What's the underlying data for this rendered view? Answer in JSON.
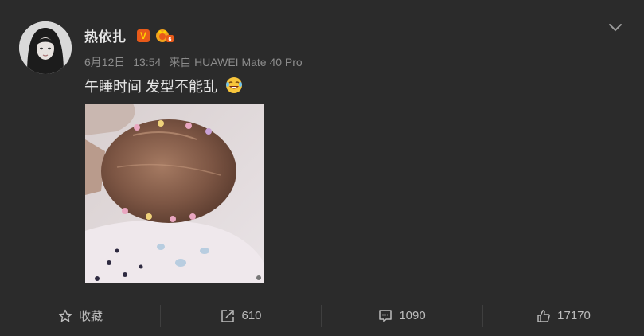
{
  "post": {
    "author": "热依扎",
    "verified_badge": "V",
    "meta": {
      "date": "6月12日",
      "time": "13:54",
      "source": "来自 HUAWEI Mate 40 Pro"
    },
    "text": "午睡时间 发型不能乱",
    "emoji_icon": "laughing-tears-icon"
  },
  "actions": {
    "favorite_label": "收藏",
    "repost_count": "610",
    "comment_count": "1090",
    "like_count": "17170"
  },
  "colors": {
    "background": "#2b2b2b",
    "verified": "#e85a19",
    "badge_gold": "#ffd200"
  }
}
